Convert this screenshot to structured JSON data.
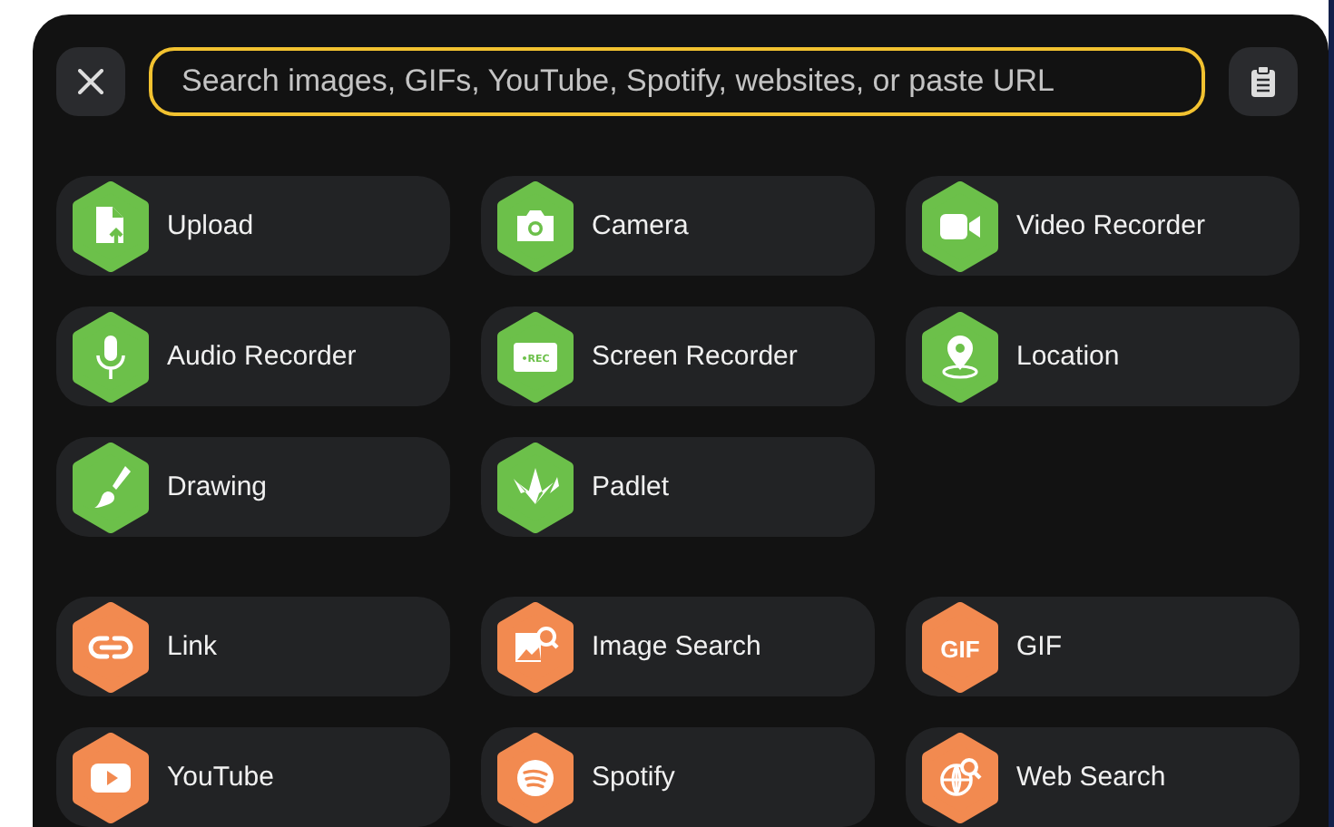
{
  "search": {
    "placeholder": "Search images, GIFs, YouTube, Spotify, websites, or paste URL"
  },
  "sections": [
    {
      "color": "#6cc04a",
      "items": [
        {
          "label": "Upload",
          "kind": "upload"
        },
        {
          "label": "Camera",
          "kind": "camera"
        },
        {
          "label": "Video Recorder",
          "kind": "video"
        },
        {
          "label": "Audio Recorder",
          "kind": "microphone"
        },
        {
          "label": "Screen Recorder",
          "kind": "screen",
          "icon_text": "•REC"
        },
        {
          "label": "Location",
          "kind": "location"
        },
        {
          "label": "Drawing",
          "kind": "brush"
        },
        {
          "label": "Padlet",
          "kind": "crane"
        }
      ]
    },
    {
      "color": "#f28a50",
      "items": [
        {
          "label": "Link",
          "kind": "link"
        },
        {
          "label": "Image Search",
          "kind": "imagesearch"
        },
        {
          "label": "GIF",
          "kind": "gif",
          "icon_text": "GIF"
        },
        {
          "label": "YouTube",
          "kind": "play"
        },
        {
          "label": "Spotify",
          "kind": "spotify"
        },
        {
          "label": "Web Search",
          "kind": "globe"
        }
      ]
    }
  ]
}
